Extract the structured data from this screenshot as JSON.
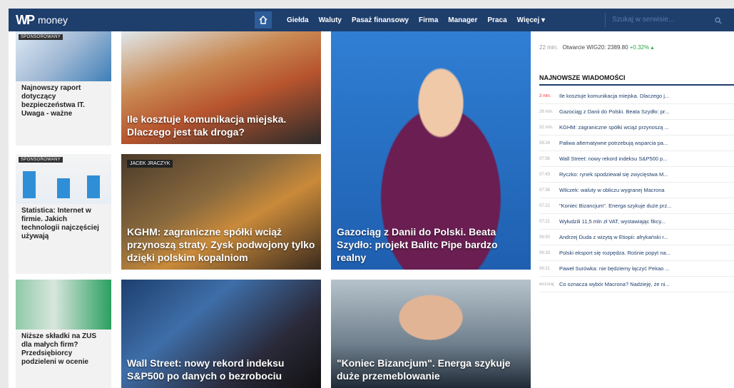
{
  "navbar": {
    "logo_mark": "WP",
    "logo_text": "money",
    "items": [
      "Giełda",
      "Waluty",
      "Pasaż finansowy",
      "Firma",
      "Manager",
      "Praca",
      "Więcej ▾"
    ],
    "search_placeholder": "Szukaj w serwisie..."
  },
  "sidebar": [
    {
      "badge": "SPONSOROWANY",
      "caption": "Najnowszy raport dotyczący bezpieczeństwa IT. Uwaga - ważne"
    },
    {
      "badge": "SPONSOROWANY",
      "caption": "Statistica: Internet w firmie. Jakich technologii najczęściej używają"
    },
    {
      "badge": "",
      "caption": "Niższe składki na ZUS dla małych firm? Przedsiębiorcy podzieleni w ocenie"
    }
  ],
  "tiles": [
    {
      "title": "Ile kosztuje komunikacja miejska. Dlaczego jest tak droga?",
      "tag": ""
    },
    {
      "title": "KGHM: zagraniczne spółki wciąż przynoszą straty. Zysk podwojony tylko dzięki polskim kopalniom",
      "tag": "JACEK JRACZYK"
    },
    {
      "title": "Wall Street: nowy rekord indeksu S&P500 po danych o bezrobociu",
      "tag": ""
    },
    {
      "title": "Gazociąg z Danii do Polski. Beata Szydło: projekt Balitc Pipe bardzo realny",
      "tag": ""
    },
    {
      "title": "\"Koniec Bizancjum\". Energa szykuje duże przemeblowanie",
      "tag": ""
    }
  ],
  "right": {
    "wig_time": "22 min.",
    "wig_text": "Otwarcie WIG20: 2389.80",
    "wig_change": "+0.32% ▴",
    "news_header": "NAJNOWSZE WIADOMOŚCI",
    "news": [
      {
        "time": "3 min.",
        "text": "Ile kosztuje komunikacja miejska. Dlaczego j..."
      },
      {
        "time": "26 min.",
        "text": "Gazociąg z Danii do Polski. Beata Szydło: pr..."
      },
      {
        "time": "32 min.",
        "text": "KGHM: zagraniczne spółki wciąż przynoszą ..."
      },
      {
        "time": "08:24",
        "text": "Paliwa alternatywne potrzebują wsparcia pa..."
      },
      {
        "time": "07:56",
        "text": "Wall Street: nowy rekord indeksu S&P500 p..."
      },
      {
        "time": "07:43",
        "text": "Ryczko: rynek spodziewał się zwycięstwa M..."
      },
      {
        "time": "07:36",
        "text": "Wilczek: waluty w obliczu wygranej Macrona"
      },
      {
        "time": "07:22",
        "text": "\"Koniec Bizancjum\". Energa szykuje duże prz..."
      },
      {
        "time": "07:21",
        "text": "Wyłudzili 11,5 mln zł VAT, wystawiając fikcy..."
      },
      {
        "time": "06:50",
        "text": "Andrzej Duda z wizytą w Etiopii: afrykański r..."
      },
      {
        "time": "06:33",
        "text": "Polski eksport się rozpędza. Rośnie popyt na..."
      },
      {
        "time": "06:21",
        "text": "Paweł Surówka: nie będziemy łączyć Pekao ..."
      },
      {
        "time": "wczoraj",
        "text": "Co oznacza wybór Macrona? Nadzieję, że ni..."
      }
    ]
  }
}
